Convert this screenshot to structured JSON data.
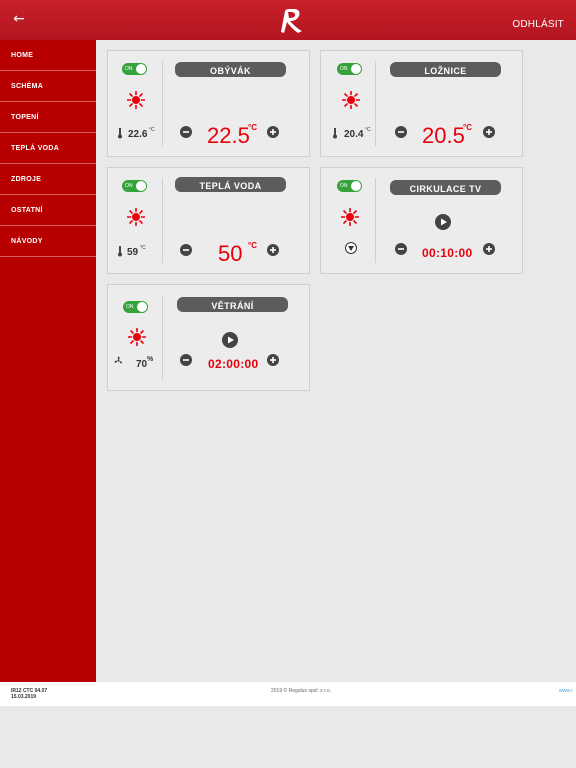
{
  "header": {
    "back_glyph": "←",
    "logo": "R",
    "logout_label": "ODHLÁSIT",
    "bar_color": "#c11a23"
  },
  "sidebar": {
    "items": [
      {
        "label": "HOME"
      },
      {
        "label": "SCHÉMA"
      },
      {
        "label": "TOPENÍ"
      },
      {
        "label": "TEPLÁ VODA"
      },
      {
        "label": "ZDROJE"
      },
      {
        "label": "OSTATNÍ"
      },
      {
        "label": "NÁVODY"
      }
    ],
    "color": "#b80000"
  },
  "tiles": {
    "obyvak": {
      "title": "OBÝVÁK",
      "toggle": "ON",
      "current": "22.6",
      "current_unit": "°C",
      "setpoint": "22.5",
      "setpoint_unit": "°C"
    },
    "loznice": {
      "title": "LOŽNICE",
      "toggle": "ON",
      "current": "20.4",
      "current_unit": "°C",
      "setpoint": "20.5",
      "setpoint_unit": "°C"
    },
    "tepla": {
      "title": "TEPLÁ VODA",
      "toggle": "ON",
      "current": "59",
      "current_unit": "°C",
      "setpoint": "50",
      "setpoint_unit": "°C"
    },
    "cirkulace": {
      "title": "CIRKULACE TV",
      "toggle": "ON",
      "timer": "00:10:00"
    },
    "vetrani": {
      "title": "VĚTRÁNÍ",
      "toggle": "ON",
      "humidity": "70",
      "humidity_unit": "%",
      "timer": "02:00:00"
    }
  },
  "icons": [
    "back-arrow-icon",
    "regulus-logo-icon",
    "sun-icon",
    "thermometer-icon",
    "minus-icon",
    "plus-icon",
    "play-icon",
    "pump-icon",
    "fan-icon"
  ],
  "colors": {
    "accent_red": "#e8000c",
    "toggle_green": "#35a23c",
    "pill_gray": "#5c5c5c"
  },
  "footer": {
    "version": "IR12 CTC 04.07",
    "date": "15.03.2019",
    "copyright": "2019 © Regulus spol. s r.o.",
    "web": "www.r"
  }
}
